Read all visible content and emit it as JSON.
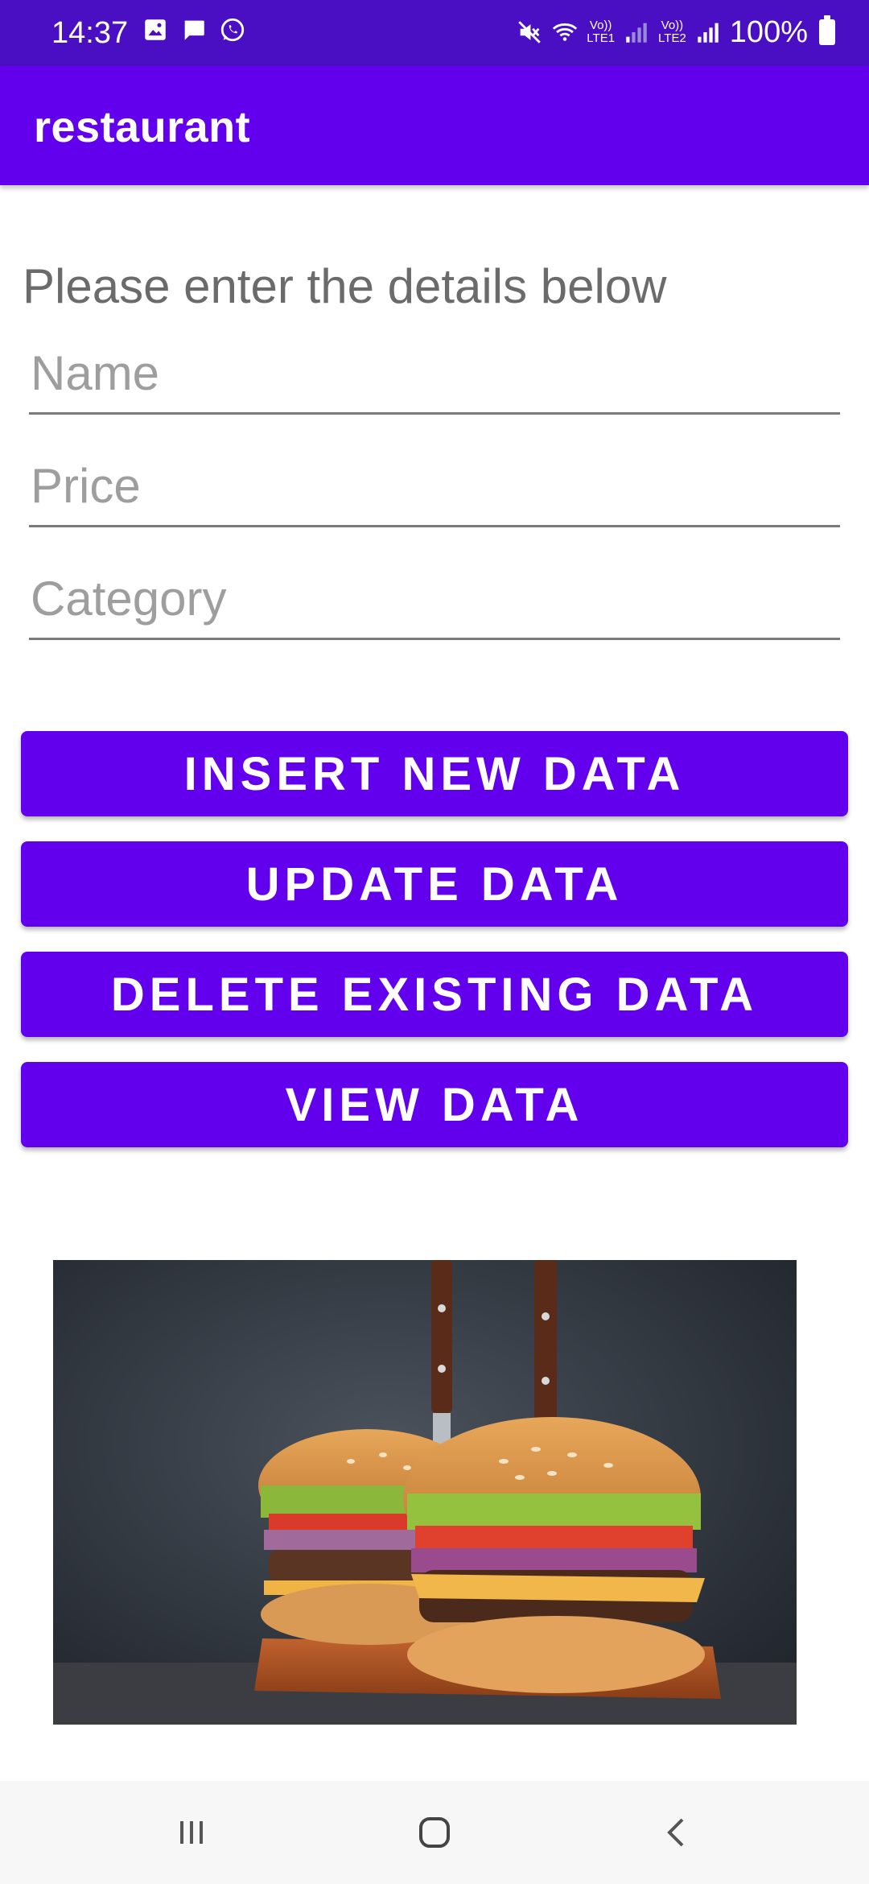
{
  "status_bar": {
    "time": "14:37",
    "battery": "100%",
    "sim1_label": [
      "Vo))",
      "LTE1"
    ],
    "sim2_label": [
      "Vo))",
      "LTE2"
    ],
    "icons": [
      "image-icon",
      "message-icon",
      "whatsapp-icon",
      "mute-icon",
      "wifi-icon",
      "signal-icon",
      "signal-icon",
      "battery-icon"
    ],
    "background_color": "#4a0fc2"
  },
  "app_bar": {
    "title": "restaurant",
    "color": "#6200ee"
  },
  "form": {
    "prompt": "Please enter the details below",
    "name_placeholder": "Name",
    "price_placeholder": "Price",
    "category_placeholder": "Category"
  },
  "buttons": {
    "insert_label": "INSERT NEW DATA",
    "update_label": "UPDATE DATA",
    "delete_label": "DELETE EXISTING DATA",
    "view_label": "VIEW DATA",
    "color": "#6200ee"
  },
  "image": {
    "subject": "two burgers with knives on a wooden board"
  },
  "nav_bar": {
    "icons": [
      "recent-apps-icon",
      "home-icon",
      "back-icon"
    ]
  }
}
